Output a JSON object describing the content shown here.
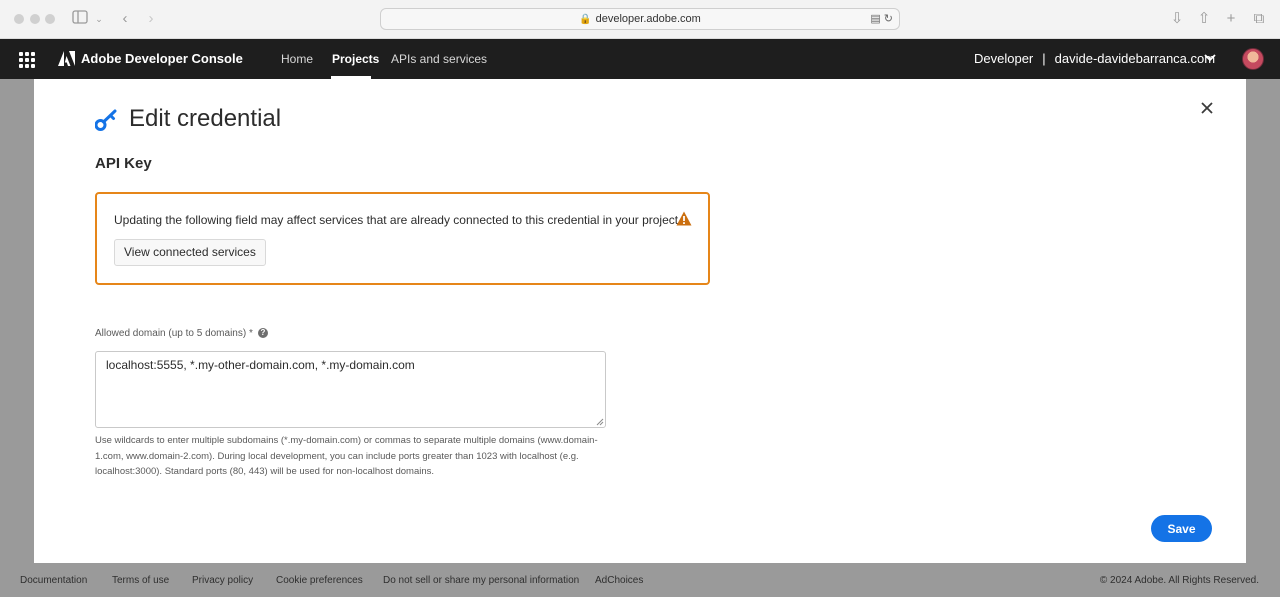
{
  "browser": {
    "url": "developer.adobe.com",
    "colors": {
      "chrome_bg": "#f3f3f3"
    }
  },
  "header": {
    "app_title": "Adobe Developer Console",
    "nav": [
      {
        "label": "Home",
        "active": false
      },
      {
        "label": "Projects",
        "active": true
      },
      {
        "label": "APIs and services",
        "active": false
      }
    ],
    "org_label": "Developer",
    "separator": "|",
    "org_name": "davide-davidebarranca.com",
    "colors": {
      "bg": "#1e1e1e"
    }
  },
  "modal": {
    "title": "Edit credential",
    "section_title": "API Key",
    "alert": {
      "message": "Updating the following field may affect services that are already connected to this credential in your project.",
      "button_label": "View connected services",
      "color": "#e68619"
    },
    "field": {
      "label": "Allowed domain (up to 5 domains) *",
      "value": "localhost:5555, *.my-other-domain.com, *.my-domain.com",
      "help_text": "Use wildcards to enter multiple subdomains (*.my-domain.com) or commas to separate multiple domains (www.domain-1.com, www.domain-2.com). During local development, you can include ports greater than 1023 with localhost (e.g. localhost:3000). Standard ports (80, 443) will be used for non-localhost domains."
    },
    "save_label": "Save",
    "accent": "#1473e6"
  },
  "footer": {
    "links": [
      "Documentation",
      "Terms of use",
      "Privacy policy",
      "Cookie preferences",
      "Do not sell or share my personal information",
      "AdChoices"
    ],
    "copyright": "© 2024 Adobe. All Rights Reserved."
  }
}
